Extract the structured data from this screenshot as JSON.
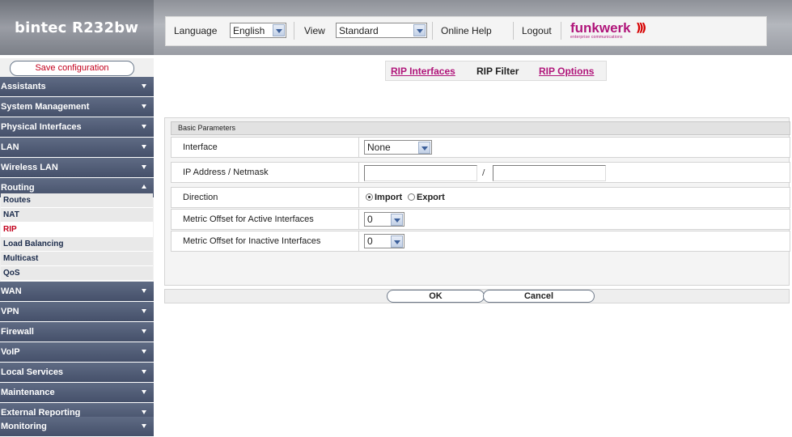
{
  "header": {
    "product": "bintec R232bw",
    "language_label": "Language",
    "language_value": "English",
    "view_label": "View",
    "view_value": "Standard",
    "online_help": "Online Help",
    "logout": "Logout",
    "logo_text": "funkwerk",
    "logo_waves": ")))",
    "logo_tagline": "enterprise communications",
    "logo_color": "#b0157a"
  },
  "sidebar": {
    "save_label": "Save configuration",
    "items": [
      {
        "label": "Assistants"
      },
      {
        "label": "System Management"
      },
      {
        "label": "Physical Interfaces"
      },
      {
        "label": "LAN"
      },
      {
        "label": "Wireless LAN"
      },
      {
        "label": "Routing",
        "expanded": true
      },
      {
        "label": "WAN"
      },
      {
        "label": "VPN"
      },
      {
        "label": "Firewall"
      },
      {
        "label": "VoIP"
      },
      {
        "label": "Local Services"
      },
      {
        "label": "Maintenance"
      },
      {
        "label": "External Reporting"
      },
      {
        "label": "Monitoring"
      }
    ],
    "routing_sub": [
      {
        "label": "Routes"
      },
      {
        "label": "NAT"
      },
      {
        "label": "RIP",
        "active": true
      },
      {
        "label": "Load Balancing"
      },
      {
        "label": "Multicast"
      },
      {
        "label": "QoS"
      }
    ],
    "active_color": "#c2001c"
  },
  "tabs": [
    {
      "label": "RIP Interfaces",
      "active": false
    },
    {
      "label": "RIP Filter",
      "active": true
    },
    {
      "label": "RIP Options",
      "active": false
    }
  ],
  "form": {
    "section_title": "Basic Parameters",
    "interface_label": "Interface",
    "interface_value": "None",
    "ip_label": "IP Address / Netmask",
    "ip_value": "",
    "netmask_value": "",
    "ip_separator": "/",
    "direction_label": "Direction",
    "direction_options": [
      "Import",
      "Export"
    ],
    "direction_selected": "Import",
    "metric_active_label": "Metric Offset for Active Interfaces",
    "metric_active_value": "0",
    "metric_inactive_label": "Metric Offset for Inactive Interfaces",
    "metric_inactive_value": "0"
  },
  "actions": {
    "ok": "OK",
    "cancel": "Cancel"
  }
}
